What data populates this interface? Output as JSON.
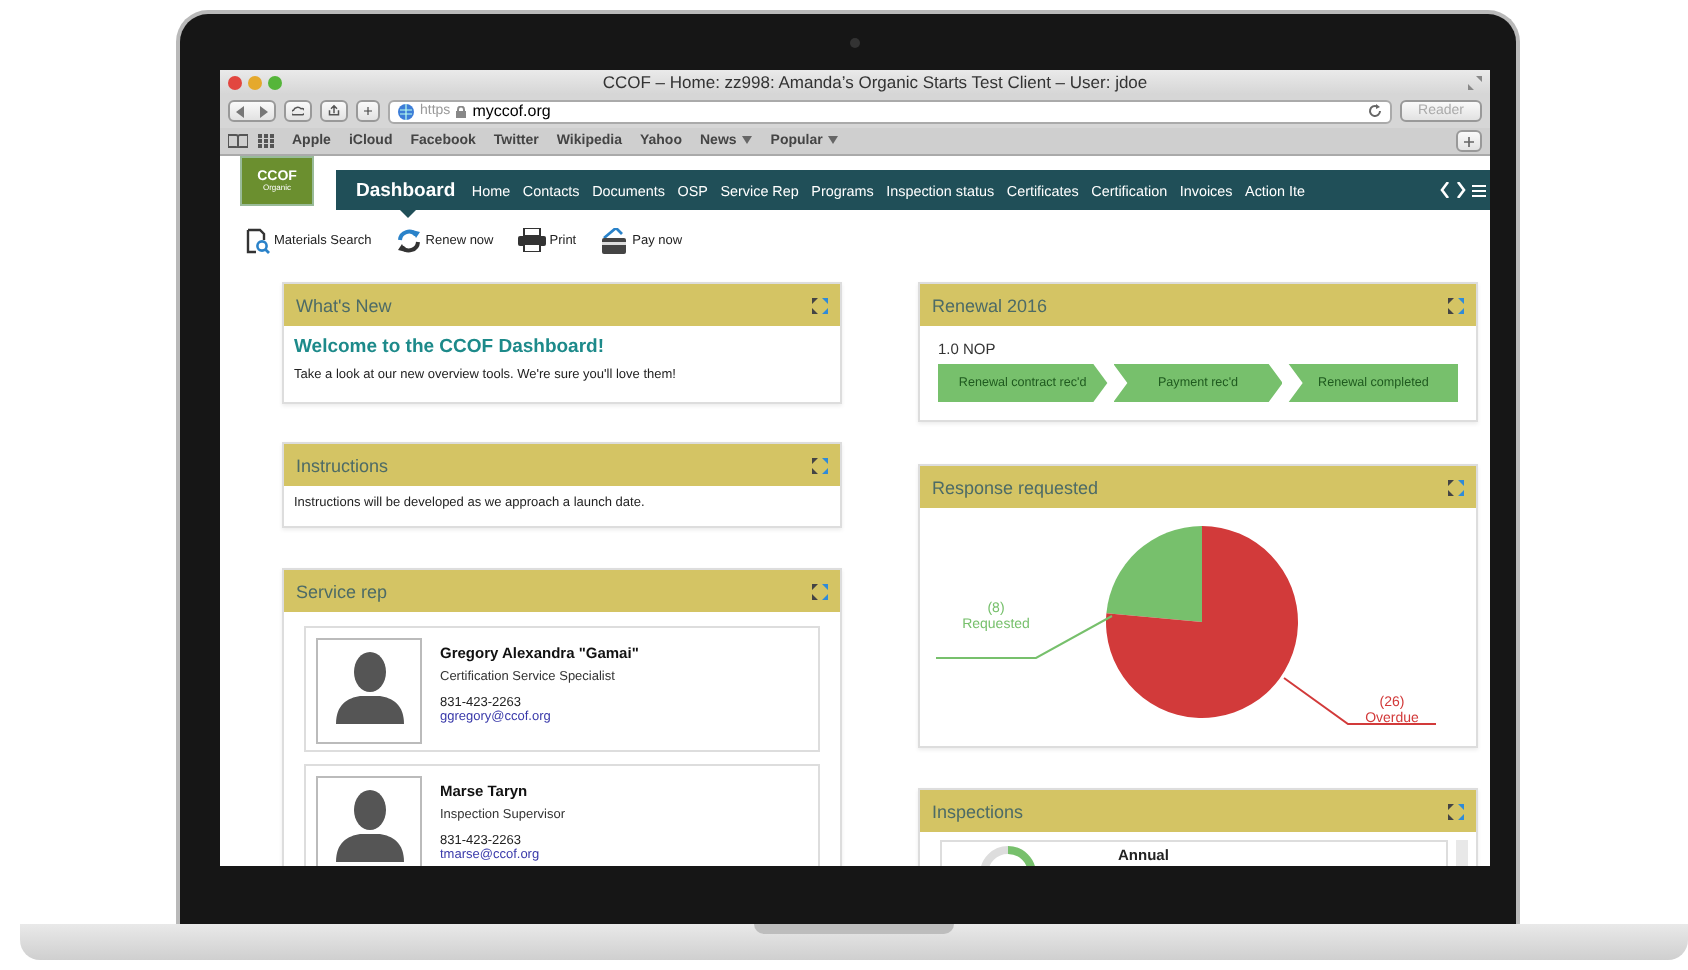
{
  "browser": {
    "title": "CCOF – Home: zz998: Amanda’s Organic Starts Test Client – User: jdoe",
    "url_scheme": "https",
    "url": "myccof.org",
    "reader": "Reader",
    "bookmarks": [
      {
        "label": "Apple",
        "menu": false
      },
      {
        "label": "iCloud",
        "menu": false
      },
      {
        "label": "Facebook",
        "menu": false
      },
      {
        "label": "Twitter",
        "menu": false
      },
      {
        "label": "Wikipedia",
        "menu": false
      },
      {
        "label": "Yahoo",
        "menu": false
      },
      {
        "label": "News",
        "menu": true
      },
      {
        "label": "Popular",
        "menu": true
      }
    ]
  },
  "site": {
    "logo": "CCOF",
    "logo_sub": "Organic",
    "nav": [
      {
        "label": "Dashboard",
        "selected": true
      },
      {
        "label": "Home",
        "selected": false
      },
      {
        "label": "Contacts",
        "selected": false
      },
      {
        "label": "Documents",
        "selected": false
      },
      {
        "label": "OSP",
        "selected": false
      },
      {
        "label": "Service Rep",
        "selected": false
      },
      {
        "label": "Programs",
        "selected": false
      },
      {
        "label": "Inspection status",
        "selected": false
      },
      {
        "label": "Certificates",
        "selected": false
      },
      {
        "label": "Certification",
        "selected": false
      },
      {
        "label": "Invoices",
        "selected": false
      },
      {
        "label": "Action Ite",
        "selected": false
      }
    ],
    "actions": [
      {
        "label": "Materials Search",
        "kind": "search"
      },
      {
        "label": "Renew now",
        "kind": "renew"
      },
      {
        "label": "Print",
        "kind": "print"
      },
      {
        "label": "Pay now",
        "kind": "pay"
      }
    ]
  },
  "whats_new": {
    "title": "What's New",
    "heading": "Welcome to the CCOF Dashboard!",
    "text": "Take a look at our new overview tools. We're sure you'll love them!"
  },
  "instructions": {
    "title": "Instructions",
    "text": "Instructions will be developed as we approach a launch date."
  },
  "service_rep": {
    "title": "Service rep",
    "reps": [
      {
        "name": "Gregory Alexandra \"Gamai\"",
        "role": "Certification Service Specialist",
        "phone": "831-423-2263",
        "email": "ggregory@ccof.org"
      },
      {
        "name": "Marse Taryn",
        "role": "Inspection Supervisor",
        "phone": "831-423-2263",
        "email": "tmarse@ccof.org"
      }
    ]
  },
  "renewal": {
    "title": "Renewal 2016",
    "program": "1.0 NOP",
    "steps": [
      {
        "label": "Renewal contract rec'd",
        "done": true
      },
      {
        "label": "Payment rec'd",
        "done": true
      },
      {
        "label": "Renewal completed",
        "done": true
      }
    ]
  },
  "response": {
    "title": "Response requested",
    "slices": [
      {
        "color": "#77c06c"
      },
      {
        "color": "#d23a3a"
      }
    ],
    "chart_data": {
      "type": "pie",
      "categories": [
        "Requested",
        "Overdue"
      ],
      "values": [
        8,
        26
      ],
      "value_labels": [
        "(8)",
        "(26)"
      ]
    }
  },
  "inspections": {
    "title": "Inspections",
    "items": [
      {
        "label": "Annual"
      }
    ]
  }
}
